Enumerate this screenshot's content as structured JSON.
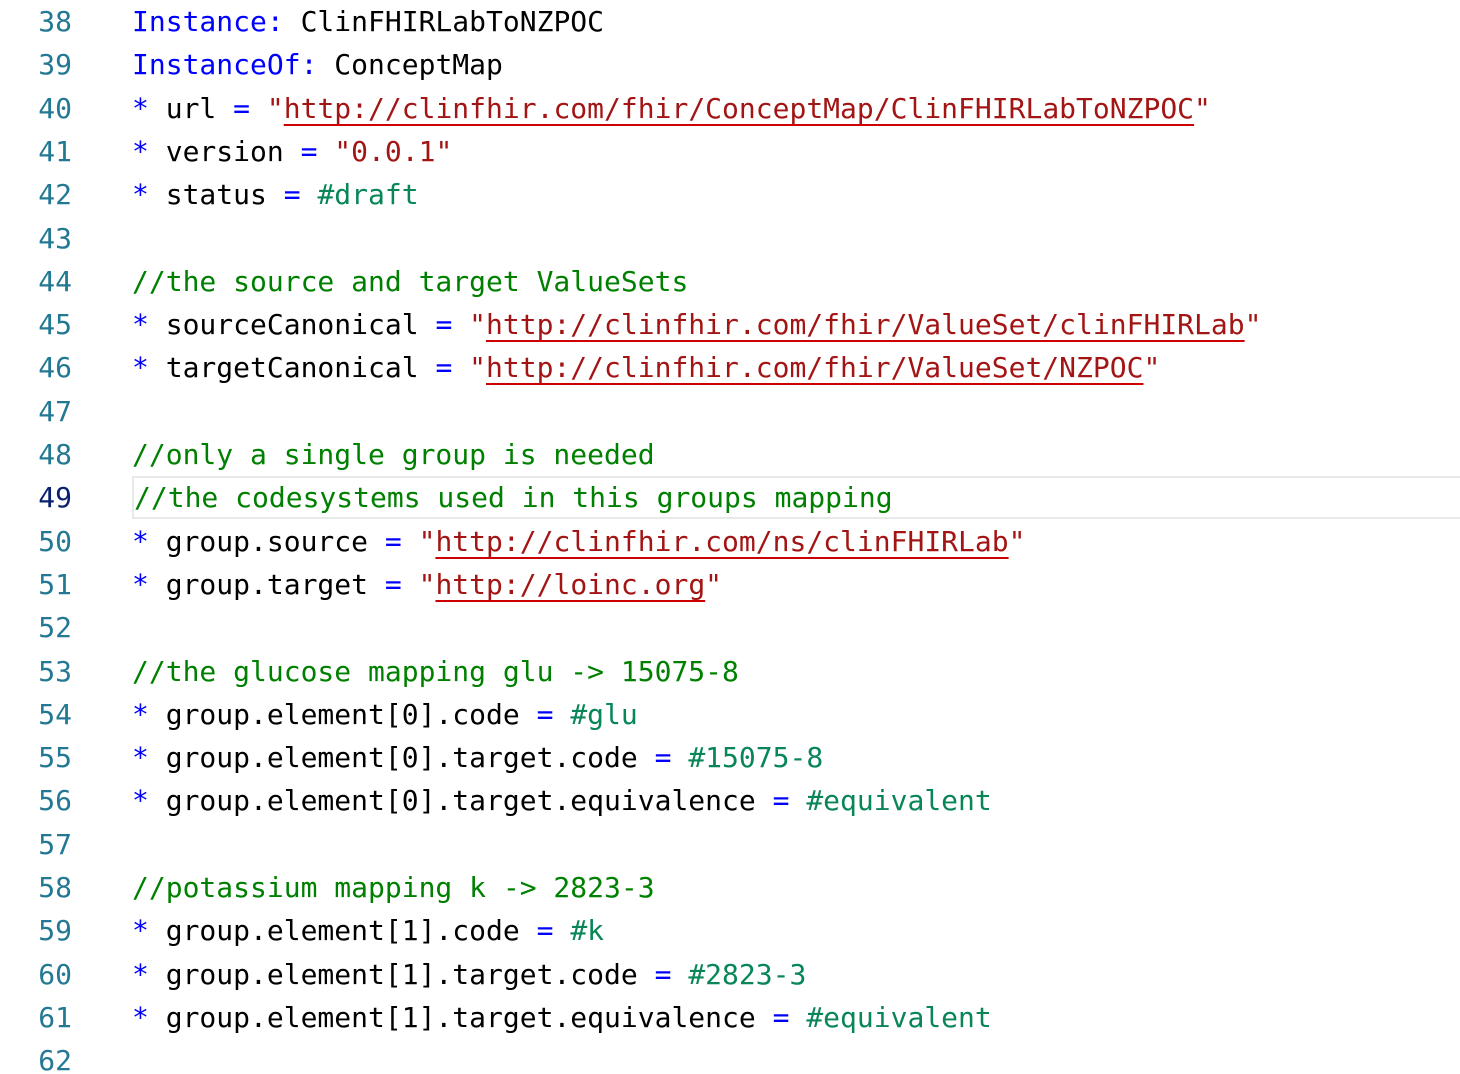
{
  "editor": {
    "theme_colors": {
      "line_number": "#237893",
      "line_number_active": "#0b216f",
      "keyword": "#0000ff",
      "string": "#a31515",
      "code_literal": "#098658",
      "comment": "#008000",
      "current_line_border": "#e9e9e9"
    },
    "current_line": 49,
    "lines": [
      {
        "n": "38",
        "tokens": [
          {
            "k": "kw",
            "t": "Instance:"
          },
          {
            "k": "plain",
            "t": " ClinFHIRLabToNZPOC"
          }
        ]
      },
      {
        "n": "39",
        "tokens": [
          {
            "k": "kw",
            "t": "InstanceOf:"
          },
          {
            "k": "plain",
            "t": " ConceptMap"
          }
        ]
      },
      {
        "n": "40",
        "tokens": [
          {
            "k": "op",
            "t": "*"
          },
          {
            "k": "plain",
            "t": " url "
          },
          {
            "k": "op",
            "t": "="
          },
          {
            "k": "plain",
            "t": " "
          },
          {
            "k": "str",
            "t": "\""
          },
          {
            "k": "url",
            "t": "http://clinfhir.com/fhir/ConceptMap/ClinFHIRLabToNZPOC"
          },
          {
            "k": "str",
            "t": "\""
          }
        ]
      },
      {
        "n": "41",
        "tokens": [
          {
            "k": "op",
            "t": "*"
          },
          {
            "k": "plain",
            "t": " version "
          },
          {
            "k": "op",
            "t": "="
          },
          {
            "k": "plain",
            "t": " "
          },
          {
            "k": "str",
            "t": "\"0.0.1\""
          }
        ]
      },
      {
        "n": "42",
        "tokens": [
          {
            "k": "op",
            "t": "*"
          },
          {
            "k": "plain",
            "t": " status "
          },
          {
            "k": "op",
            "t": "="
          },
          {
            "k": "plain",
            "t": " "
          },
          {
            "k": "code",
            "t": "#draft"
          }
        ]
      },
      {
        "n": "43",
        "tokens": []
      },
      {
        "n": "44",
        "tokens": [
          {
            "k": "cmt",
            "t": "//the source and target ValueSets"
          }
        ]
      },
      {
        "n": "45",
        "tokens": [
          {
            "k": "op",
            "t": "*"
          },
          {
            "k": "plain",
            "t": " sourceCanonical "
          },
          {
            "k": "op",
            "t": "="
          },
          {
            "k": "plain",
            "t": " "
          },
          {
            "k": "str",
            "t": "\""
          },
          {
            "k": "url",
            "t": "http://clinfhir.com/fhir/ValueSet/clinFHIRLab"
          },
          {
            "k": "str",
            "t": "\""
          }
        ]
      },
      {
        "n": "46",
        "tokens": [
          {
            "k": "op",
            "t": "*"
          },
          {
            "k": "plain",
            "t": " targetCanonical "
          },
          {
            "k": "op",
            "t": "="
          },
          {
            "k": "plain",
            "t": " "
          },
          {
            "k": "str",
            "t": "\""
          },
          {
            "k": "url",
            "t": "http://clinfhir.com/fhir/ValueSet/NZPOC"
          },
          {
            "k": "str",
            "t": "\""
          }
        ]
      },
      {
        "n": "47",
        "tokens": []
      },
      {
        "n": "48",
        "tokens": [
          {
            "k": "cmt",
            "t": "//only a single group is needed"
          }
        ]
      },
      {
        "n": "49",
        "tokens": [
          {
            "k": "cmt",
            "t": "//the codesystems used in this groups mapping"
          }
        ]
      },
      {
        "n": "50",
        "tokens": [
          {
            "k": "op",
            "t": "*"
          },
          {
            "k": "plain",
            "t": " group.source "
          },
          {
            "k": "op",
            "t": "="
          },
          {
            "k": "plain",
            "t": " "
          },
          {
            "k": "str",
            "t": "\""
          },
          {
            "k": "url",
            "t": "http://clinfhir.com/ns/clinFHIRLab"
          },
          {
            "k": "str",
            "t": "\""
          }
        ]
      },
      {
        "n": "51",
        "tokens": [
          {
            "k": "op",
            "t": "*"
          },
          {
            "k": "plain",
            "t": " group.target "
          },
          {
            "k": "op",
            "t": "="
          },
          {
            "k": "plain",
            "t": " "
          },
          {
            "k": "str",
            "t": "\""
          },
          {
            "k": "url",
            "t": "http://loinc.org"
          },
          {
            "k": "str",
            "t": "\""
          }
        ]
      },
      {
        "n": "52",
        "tokens": []
      },
      {
        "n": "53",
        "tokens": [
          {
            "k": "cmt",
            "t": "//the glucose mapping glu -> 15075-8"
          }
        ]
      },
      {
        "n": "54",
        "tokens": [
          {
            "k": "op",
            "t": "*"
          },
          {
            "k": "plain",
            "t": " group.element[0].code "
          },
          {
            "k": "op",
            "t": "="
          },
          {
            "k": "plain",
            "t": " "
          },
          {
            "k": "code",
            "t": "#glu"
          }
        ]
      },
      {
        "n": "55",
        "tokens": [
          {
            "k": "op",
            "t": "*"
          },
          {
            "k": "plain",
            "t": " group.element[0].target.code "
          },
          {
            "k": "op",
            "t": "="
          },
          {
            "k": "plain",
            "t": " "
          },
          {
            "k": "code",
            "t": "#15075-8"
          }
        ]
      },
      {
        "n": "56",
        "tokens": [
          {
            "k": "op",
            "t": "*"
          },
          {
            "k": "plain",
            "t": " group.element[0].target.equivalence "
          },
          {
            "k": "op",
            "t": "="
          },
          {
            "k": "plain",
            "t": " "
          },
          {
            "k": "code",
            "t": "#equivalent"
          }
        ]
      },
      {
        "n": "57",
        "tokens": []
      },
      {
        "n": "58",
        "tokens": [
          {
            "k": "cmt",
            "t": "//potassium mapping k -> 2823-3"
          }
        ]
      },
      {
        "n": "59",
        "tokens": [
          {
            "k": "op",
            "t": "*"
          },
          {
            "k": "plain",
            "t": " group.element[1].code "
          },
          {
            "k": "op",
            "t": "="
          },
          {
            "k": "plain",
            "t": " "
          },
          {
            "k": "code",
            "t": "#k"
          }
        ]
      },
      {
        "n": "60",
        "tokens": [
          {
            "k": "op",
            "t": "*"
          },
          {
            "k": "plain",
            "t": " group.element[1].target.code "
          },
          {
            "k": "op",
            "t": "="
          },
          {
            "k": "plain",
            "t": " "
          },
          {
            "k": "code",
            "t": "#2823-3"
          }
        ]
      },
      {
        "n": "61",
        "tokens": [
          {
            "k": "op",
            "t": "*"
          },
          {
            "k": "plain",
            "t": " group.element[1].target.equivalence "
          },
          {
            "k": "op",
            "t": "="
          },
          {
            "k": "plain",
            "t": " "
          },
          {
            "k": "code",
            "t": "#equivalent"
          }
        ]
      },
      {
        "n": "62",
        "tokens": []
      }
    ]
  }
}
